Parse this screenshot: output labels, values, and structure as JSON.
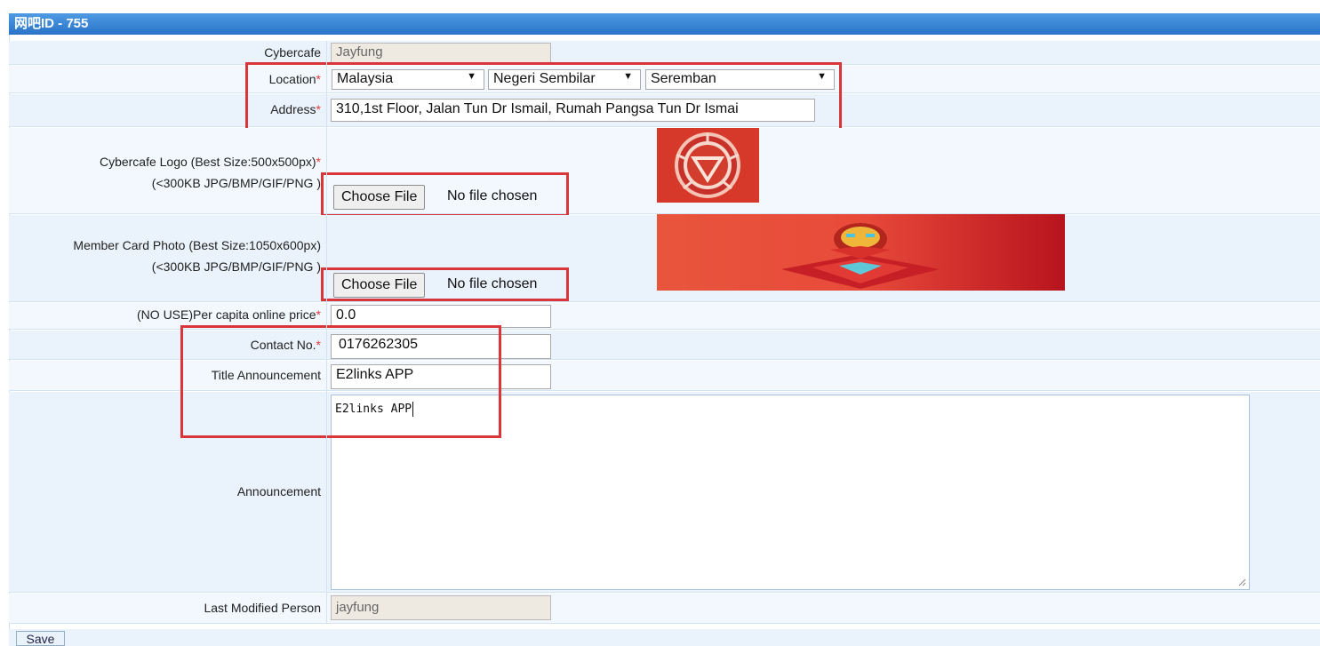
{
  "window": {
    "title": "网吧ID - 755"
  },
  "form": {
    "cybercafe": {
      "label": "Cybercafe",
      "value": "Jayfung"
    },
    "location": {
      "label": "Location",
      "country": "Malaysia",
      "state": "Negeri Sembilar",
      "city": "Seremban"
    },
    "address": {
      "label": "Address",
      "value": "310,1st Floor, Jalan Tun Dr Ismail, Rumah Pangsa Tun Dr Ismai"
    },
    "logo": {
      "label_line1": "Cybercafe Logo (Best Size:500x500px)",
      "label_line2": "(<300KB JPG/BMP/GIF/PNG )",
      "button": "Choose File",
      "status": "No file chosen"
    },
    "card": {
      "label_line1": "Member Card Photo (Best Size:1050x600px)",
      "label_line2": "(<300KB JPG/BMP/GIF/PNG )",
      "button": "Choose File",
      "status": "No file chosen"
    },
    "price": {
      "label": "(NO USE)Per capita online price",
      "value": "0.0"
    },
    "contact": {
      "label": "Contact No.",
      "value": "0176262305"
    },
    "title_announcement": {
      "label": "Title Announcement",
      "value": "E2links APP"
    },
    "announcement": {
      "label": "Announcement",
      "value": "E2links APP"
    },
    "last_modified": {
      "label": "Last Modified Person",
      "value": "jayfung"
    },
    "required_mark": "*"
  },
  "actions": {
    "save": "Save"
  },
  "colors": {
    "accent": "#2a73c8",
    "highlight": "#d8363a",
    "row_bg": "#eaf3fb"
  }
}
